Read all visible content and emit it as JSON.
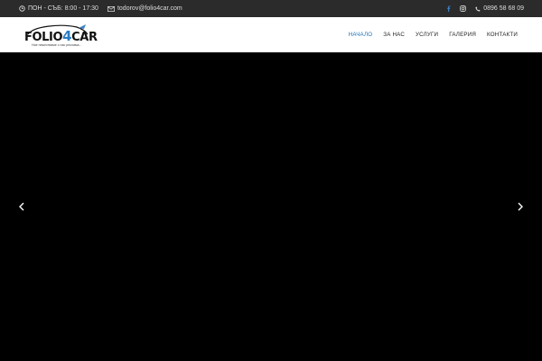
{
  "topbar": {
    "hours": "ПОН - СЪБ: 8:00 - 17:30",
    "email": "todorov@folio4car.com",
    "phone": "0896 58 68 09",
    "icons": [
      "clock-icon",
      "mail-icon",
      "facebook-icon",
      "instagram-icon",
      "phone-icon"
    ],
    "accent": "#3b82c4"
  },
  "header": {
    "logo": {
      "word_a": "FOLIO",
      "word_b": "4",
      "word_c": "CAR",
      "tagline": "Ние нежестваме с нас реклама..."
    },
    "nav": [
      {
        "label": "НАЧАЛО",
        "active": true
      },
      {
        "label": "ЗА НАС",
        "active": false
      },
      {
        "label": "УСЛУГИ",
        "active": false
      },
      {
        "label": "ГАЛЕРИЯ",
        "active": false
      },
      {
        "label": "КОНТАКТИ",
        "active": false
      }
    ],
    "active_color": "#1f6fb5"
  },
  "slider": {
    "background": "#000000",
    "prev_icon": "chevron-left-icon",
    "next_icon": "chevron-right-icon"
  }
}
